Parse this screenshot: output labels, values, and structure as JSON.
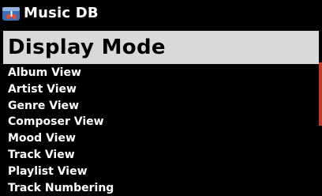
{
  "header": {
    "icon": "music-db-icon",
    "title": "Music DB"
  },
  "menu": {
    "selected": "Display Mode",
    "items": [
      "Album View",
      "Artist View",
      "Genre View",
      "Composer View",
      "Mood View",
      "Track View",
      "Playlist View",
      "Track Numbering"
    ]
  },
  "colors": {
    "background": "#000000",
    "text": "#ffffff",
    "selection_background": "#d9d9d9",
    "selection_text": "#000000",
    "scroll_thumb": "#c0392b"
  }
}
